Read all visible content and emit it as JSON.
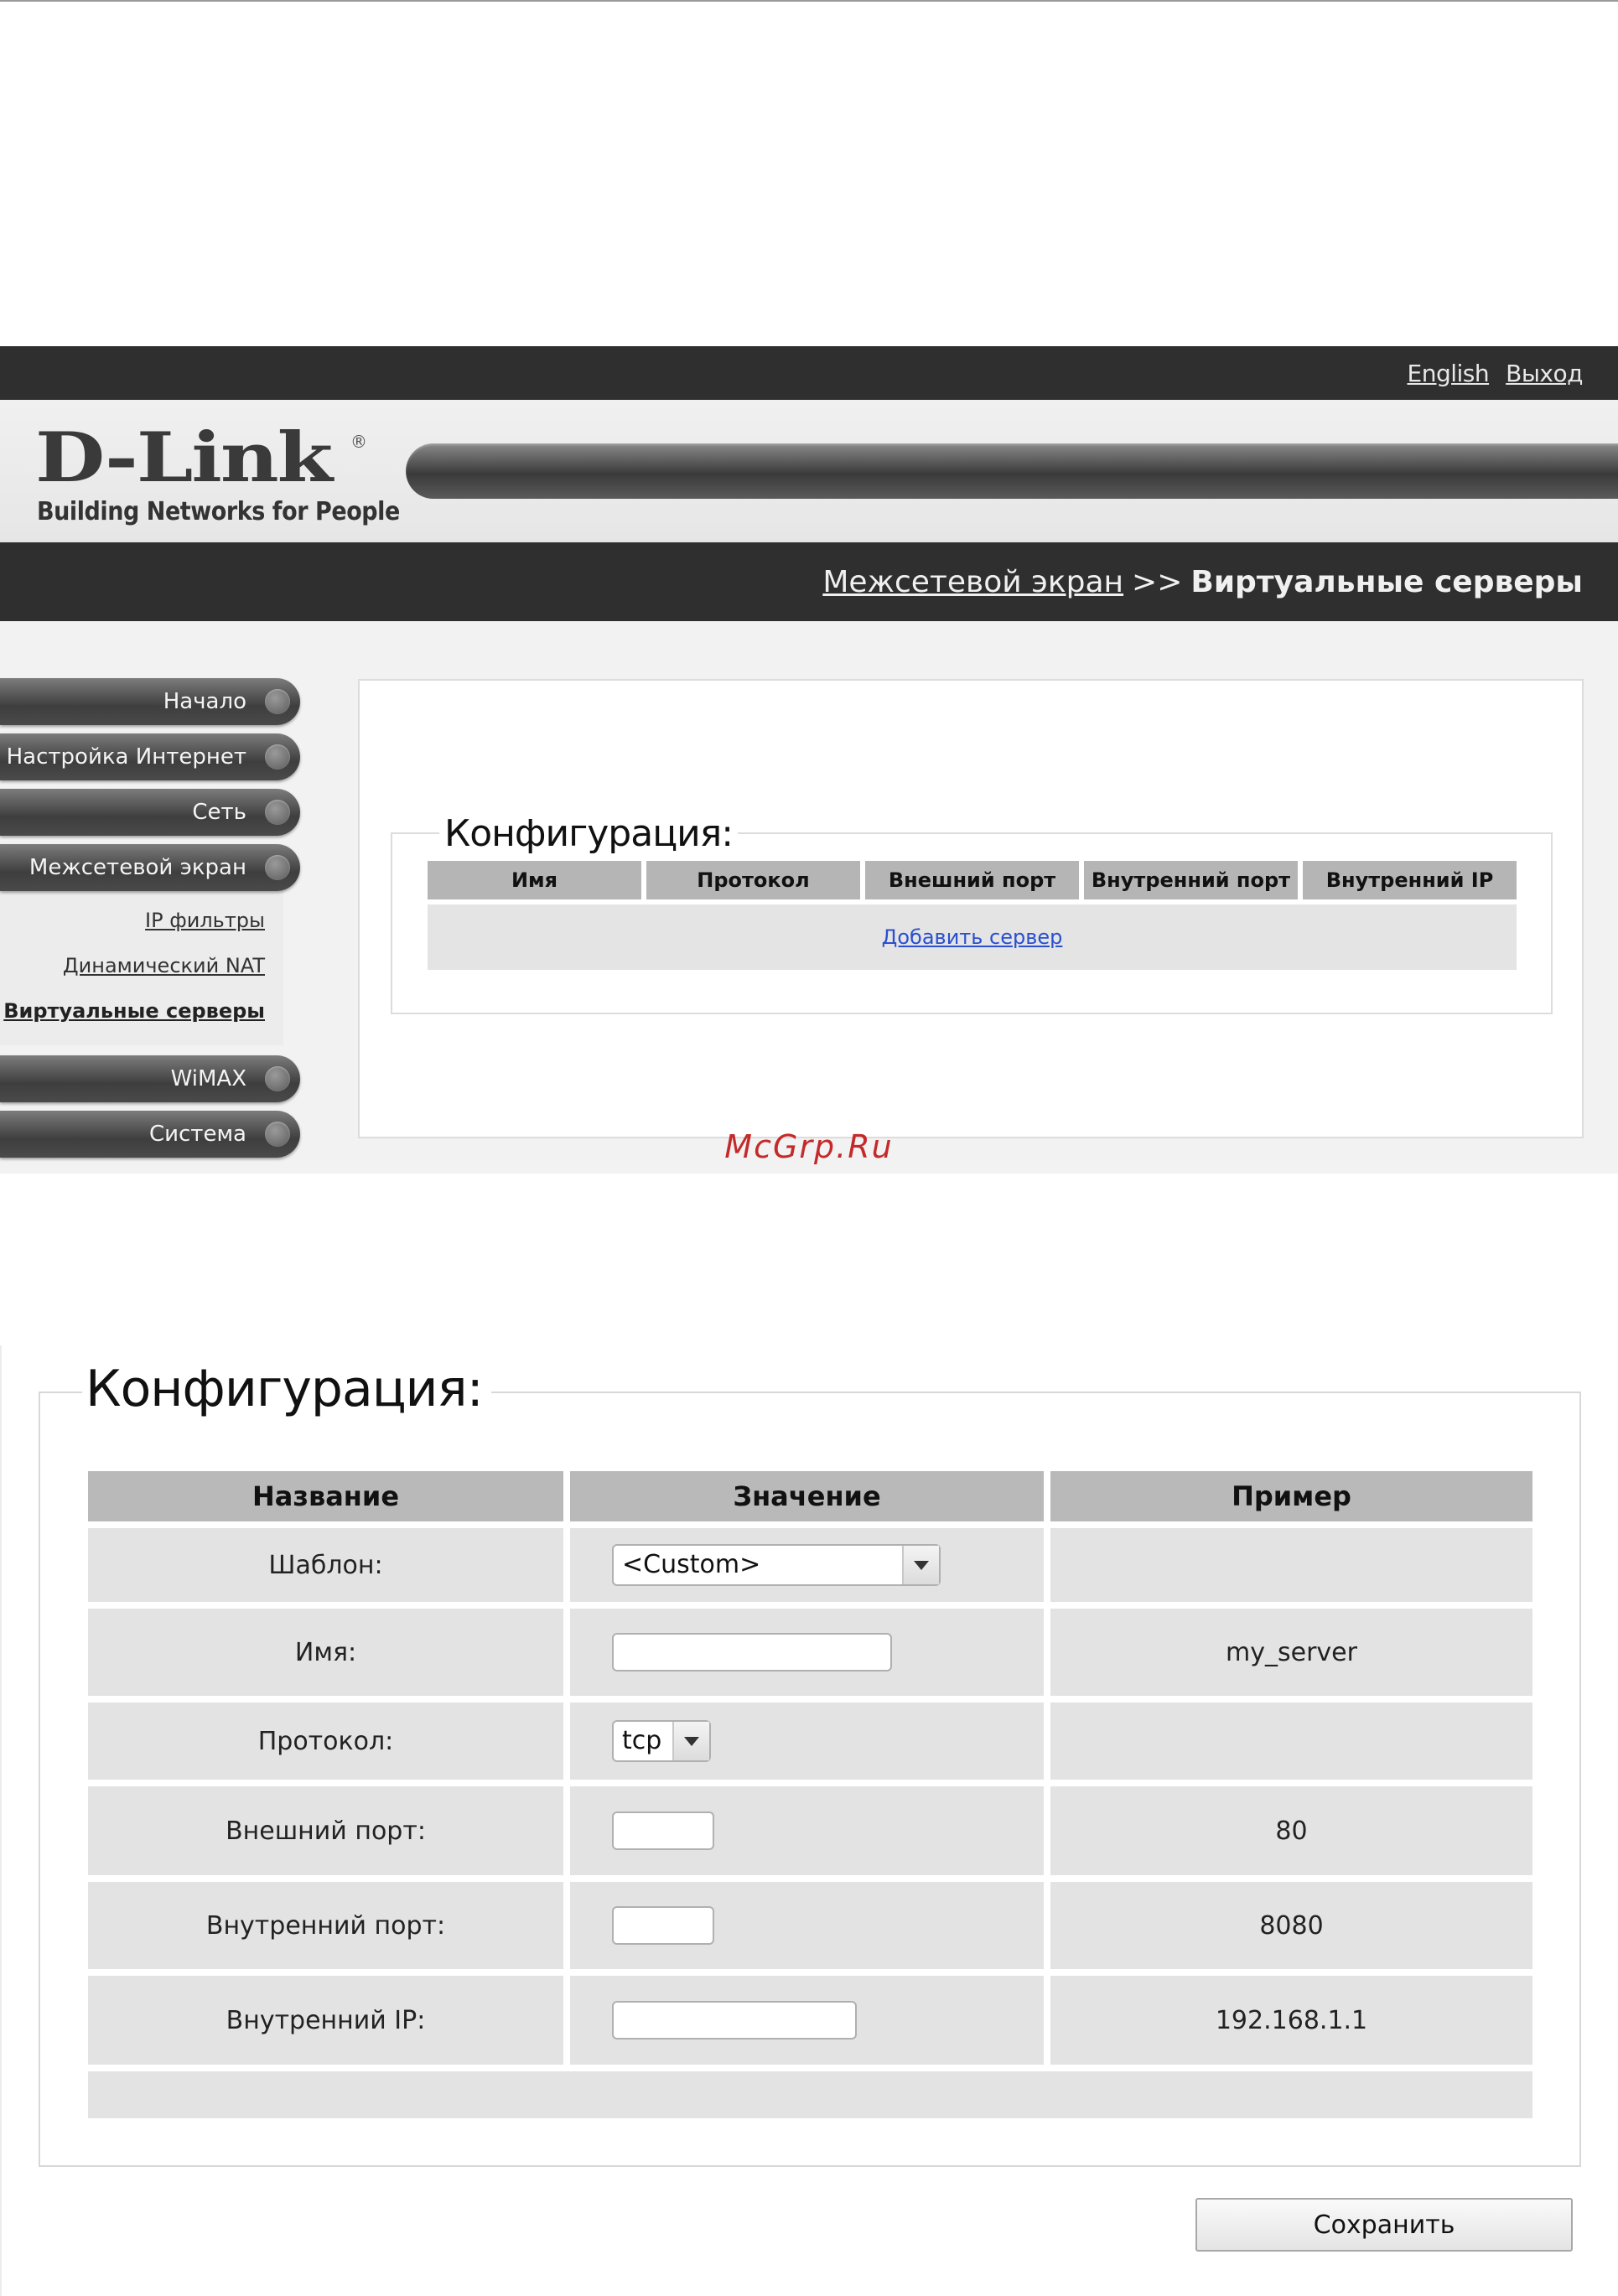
{
  "header": {
    "links": [
      "English",
      "Выход"
    ],
    "logo_text": "D-Link",
    "logo_registered": "®",
    "tagline": "Building Networks for People",
    "breadcrumb_parent": "Межсетевой экран",
    "breadcrumb_separator": ">>",
    "breadcrumb_current": "Виртуальные серверы"
  },
  "sidebar": {
    "items": [
      "Начало",
      "Настройка Интернет",
      "Сеть",
      "Межсетевой экран",
      "WiMAX",
      "Система"
    ],
    "submenu": [
      "IP фильтры",
      "Динамический NAT",
      "Виртуальные серверы"
    ],
    "active_sub": "Виртуальные серверы"
  },
  "servers": {
    "legend": "Конфигурация:",
    "columns": [
      "Имя",
      "Протокол",
      "Внешний порт",
      "Внутренний порт",
      "Внутренний IP"
    ],
    "add_link": "Добавить сервер"
  },
  "watermark": "McGrp.Ru",
  "form": {
    "legend": "Конфигурация:",
    "headers": [
      "Название",
      "Значение",
      "Пример"
    ],
    "rows": [
      {
        "label": "Шаблон:",
        "control": "select",
        "value": "<Custom>",
        "example": ""
      },
      {
        "label": "Имя:",
        "control": "text",
        "value": "",
        "example": "my_server"
      },
      {
        "label": "Протокол:",
        "control": "select",
        "value": "tcp",
        "example": ""
      },
      {
        "label": "Внешний порт:",
        "control": "text",
        "value": "",
        "example": "80"
      },
      {
        "label": "Внутренний порт:",
        "control": "text",
        "value": "",
        "example": "8080"
      },
      {
        "label": "Внутренний IP:",
        "control": "text",
        "value": "",
        "example": "192.168.1.1"
      }
    ],
    "save_label": "Сохранить"
  },
  "colors": {
    "dark_bar": "#2f2f2f",
    "link_blue": "#2a4fd0",
    "header_gray": "#b9b9b9",
    "cell_gray": "#e3e3e3",
    "watermark_red": "#c42a2a"
  }
}
